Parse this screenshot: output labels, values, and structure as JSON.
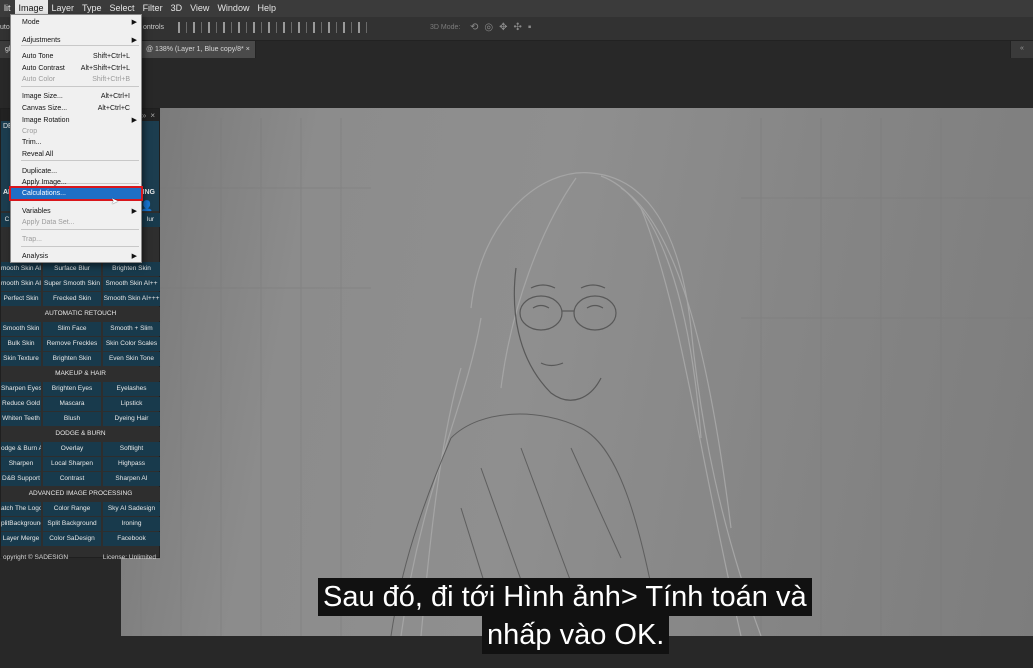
{
  "menubar": {
    "items": [
      "lit",
      "Image",
      "Layer",
      "Type",
      "Select",
      "Filter",
      "3D",
      "View",
      "Window",
      "Help"
    ]
  },
  "optbar": {
    "left_text": "uto-",
    "controls_text": "ontrols",
    "mode3d": "3D Mode:"
  },
  "tabs": [
    {
      "label": "gla"
    },
    {
      "label": "@ 138% (Layer 1, Blue copy/8*"
    }
  ],
  "image_menu": {
    "items": [
      {
        "label": "Mode",
        "shortcut": "",
        "submenu": true,
        "disabled": false
      },
      {
        "label": "Adjustments",
        "shortcut": "",
        "submenu": true,
        "disabled": false
      },
      {
        "label": "Auto Tone",
        "shortcut": "Shift+Ctrl+L",
        "submenu": false,
        "disabled": false
      },
      {
        "label": "Auto Contrast",
        "shortcut": "Alt+Shift+Ctrl+L",
        "submenu": false,
        "disabled": false
      },
      {
        "label": "Auto Color",
        "shortcut": "Shift+Ctrl+B",
        "submenu": false,
        "disabled": true
      },
      {
        "label": "Image Size...",
        "shortcut": "Alt+Ctrl+I",
        "submenu": false,
        "disabled": false
      },
      {
        "label": "Canvas Size...",
        "shortcut": "Alt+Ctrl+C",
        "submenu": false,
        "disabled": false
      },
      {
        "label": "Image Rotation",
        "shortcut": "",
        "submenu": true,
        "disabled": false
      },
      {
        "label": "Crop",
        "shortcut": "",
        "submenu": false,
        "disabled": true
      },
      {
        "label": "Trim...",
        "shortcut": "",
        "submenu": false,
        "disabled": false
      },
      {
        "label": "Reveal All",
        "shortcut": "",
        "submenu": false,
        "disabled": false
      },
      {
        "label": "Duplicate...",
        "shortcut": "",
        "submenu": false,
        "disabled": false
      },
      {
        "label": "Apply Image...",
        "shortcut": "",
        "submenu": false,
        "disabled": false
      },
      {
        "label": "Calculations...",
        "shortcut": "",
        "submenu": false,
        "disabled": false,
        "highlighted": true
      },
      {
        "label": "Variables",
        "shortcut": "",
        "submenu": true,
        "disabled": false
      },
      {
        "label": "Apply Data Set...",
        "shortcut": "",
        "submenu": false,
        "disabled": true
      },
      {
        "label": "Trap...",
        "shortcut": "",
        "submenu": false,
        "disabled": true
      },
      {
        "label": "Analysis",
        "shortcut": "",
        "submenu": true,
        "disabled": false
      }
    ]
  },
  "plugin": {
    "header_fragments": {
      "left": "DES",
      "mid_left": "AR",
      "mid_right": "ING",
      "btn_left": "C",
      "btn_right": "lur"
    },
    "rows_top": [
      [
        "mooth Skin AI",
        "Surface Blur",
        "Brighten Skin"
      ],
      [
        "mooth Skin AI+",
        "Super Smooth Skin",
        "Smooth Skin AI++"
      ],
      [
        "Perfect Skin",
        "Frecked Skin",
        "Smooth Skin AI+++"
      ]
    ],
    "sections": [
      {
        "title": "AUTOMATIC RETOUCH",
        "rows": [
          [
            "Smooth Skin",
            "Slim Face",
            "Smooth + Slim"
          ],
          [
            "Bulk Skin",
            "Remove Freckles",
            "Skin Color Scales"
          ],
          [
            "Skin Texture",
            "Brighten Skin",
            "Even Skin Tone"
          ]
        ]
      },
      {
        "title": "MAKEUP & HAIR",
        "rows": [
          [
            "Sharpen Eyes",
            "Brighten Eyes",
            "Eyelashes"
          ],
          [
            "Reduce Gold",
            "Mascara",
            "Lipstick"
          ],
          [
            "Whiten Teeth",
            "Blush",
            "Dyeing Hair"
          ]
        ]
      },
      {
        "title": "DODGE & BURN",
        "rows": [
          [
            "odge & Burn AI",
            "Overlay",
            "Softlight"
          ],
          [
            "Sharpen",
            "Local Sharpen",
            "Highpass"
          ],
          [
            "D&B Support",
            "Contrast",
            "Sharpen AI"
          ]
        ]
      },
      {
        "title": "ADVANCED IMAGE PROCESSING",
        "rows": [
          [
            "atch The Logo",
            "Color Range",
            "Sky AI Sadesign"
          ],
          [
            "plitBackground",
            "Split Background",
            "Ironing"
          ],
          [
            "Layer Merge",
            "Color SaDesign",
            "Facebook"
          ]
        ]
      }
    ],
    "footer": {
      "copyright": "opyright © SADESIGN",
      "license": "License: Unlimited"
    }
  },
  "subtitles": {
    "line1": "Sau đó, đi tới Hình ảnh> Tính toán và",
    "line2": "nhấp vào OK."
  },
  "colors": {
    "menu_highlight": "#1f6fc6",
    "highlight_border": "#d9161c",
    "plugin_button": "#183a4c"
  }
}
